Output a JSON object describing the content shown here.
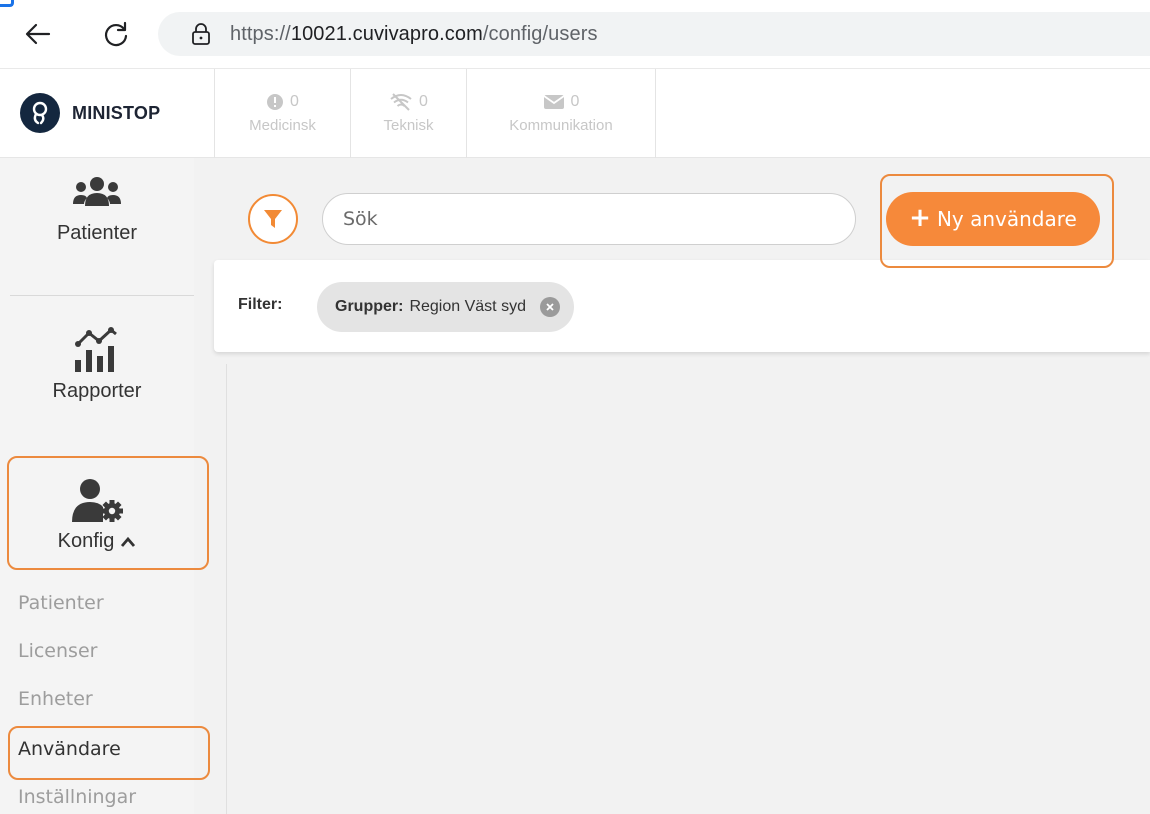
{
  "browser": {
    "url_prefix": "https://",
    "url_host": "10021.cuvivapro.com",
    "url_path": "/config/users"
  },
  "header": {
    "logo_text": "MINISTOP",
    "alerts": [
      {
        "count": "0",
        "label": "Medicinsk",
        "icon": "exclamation-circle-icon"
      },
      {
        "count": "0",
        "label": "Teknisk",
        "icon": "wifi-off-icon"
      },
      {
        "count": "0",
        "label": "Kommunikation",
        "icon": "envelope-icon"
      }
    ]
  },
  "sidebar": {
    "items": [
      {
        "label": "Patienter",
        "icon": "users-group-icon"
      },
      {
        "label": "Rapporter",
        "icon": "chart-icon"
      },
      {
        "label": "Konfig",
        "icon": "user-gear-icon"
      }
    ],
    "sub_items": [
      "Patienter",
      "Licenser",
      "Enheter",
      "Användare",
      "Inställningar"
    ],
    "active_sub_item": "Användare"
  },
  "main": {
    "search_placeholder": "Sök",
    "new_user_label": "Ny användare",
    "filter_label": "Filter:",
    "chip_key": "Grupper:",
    "chip_value": "Region Väst syd"
  },
  "colors": {
    "accent": "#f6893a",
    "highlight": "#ec8a3e",
    "logo_bg": "#14273f"
  }
}
